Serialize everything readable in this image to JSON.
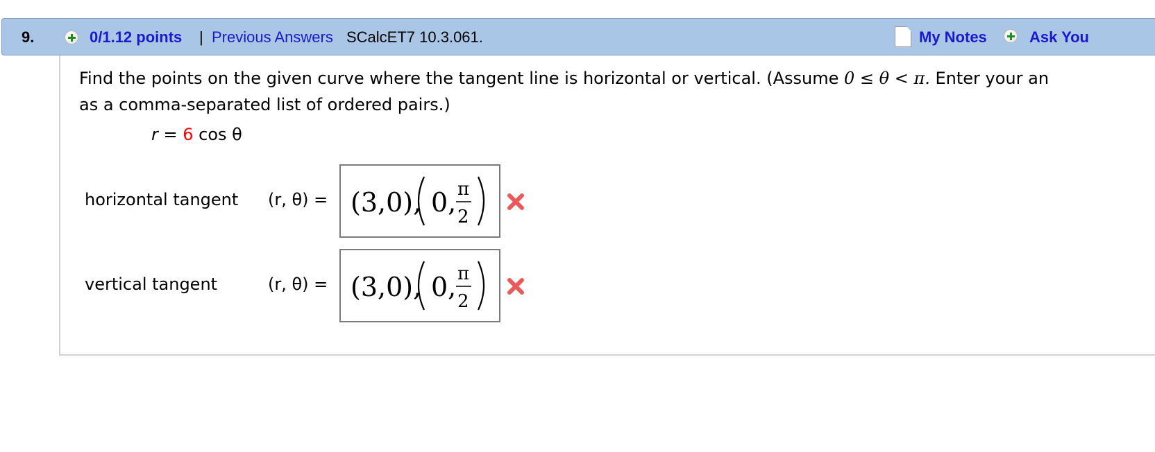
{
  "header": {
    "question_number": "9.",
    "points": "0/1.12 points",
    "separator": "|",
    "previous_answers": "Previous Answers",
    "problem_code": "SCalcET7 10.3.061.",
    "my_notes": "My Notes",
    "ask_your": "Ask You"
  },
  "question": {
    "line1_start": "Find the points on the given curve where the tangent line is horizontal or vertical. (Assume ",
    "line1_math": "0 ≤ θ < π.",
    "line1_end": " Enter your an",
    "line2": "as a comma-separated list of ordered pairs.)"
  },
  "equation": {
    "lhs": "r",
    "eq": " = ",
    "coef": "6",
    "rhs": " cos θ"
  },
  "answers": [
    {
      "label": "horizontal tangent",
      "prefix": "(r, θ) =",
      "value": "(3,0),(0,π/2)",
      "status": "incorrect"
    },
    {
      "label": "vertical tangent",
      "prefix": "(r, θ) =",
      "value": "(3,0),(0,π/2)",
      "status": "incorrect"
    }
  ],
  "icons": {
    "plus": "plus-circle-icon",
    "notes": "document-icon",
    "wrong": "x-mark-icon"
  },
  "colors": {
    "header_bg": "#a9c6e6",
    "link": "#1a1acc",
    "error": "#ff0000",
    "x_mark": "#e8595a"
  }
}
